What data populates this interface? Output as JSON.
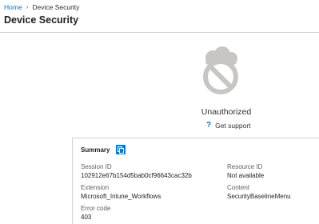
{
  "breadcrumb": {
    "home": "Home",
    "current": "Device Security"
  },
  "page": {
    "title": "Device Security"
  },
  "status": {
    "title": "Unauthorized",
    "support_link": "Get support",
    "help_glyph": "?",
    "icon": "cloud-blocked-icon"
  },
  "summary": {
    "title": "Summary",
    "copy_icon": "copy-icon",
    "fields": {
      "session_id": {
        "label": "Session ID",
        "value": "102912e67b154d5bab0cf96643cac32b"
      },
      "resource_id": {
        "label": "Resource ID",
        "value": "Not available"
      },
      "extension": {
        "label": "Extension",
        "value": "Microsoft_Intune_Workflows"
      },
      "content": {
        "label": "Content",
        "value": "SecurityBaselineMenu"
      },
      "error_code": {
        "label": "Error code",
        "value": "403"
      }
    }
  },
  "colors": {
    "accent": "#0078d4",
    "text": "#323130",
    "muted": "#605e5c",
    "divider": "#d2d0ce",
    "illustration": "#c8c6c4"
  }
}
